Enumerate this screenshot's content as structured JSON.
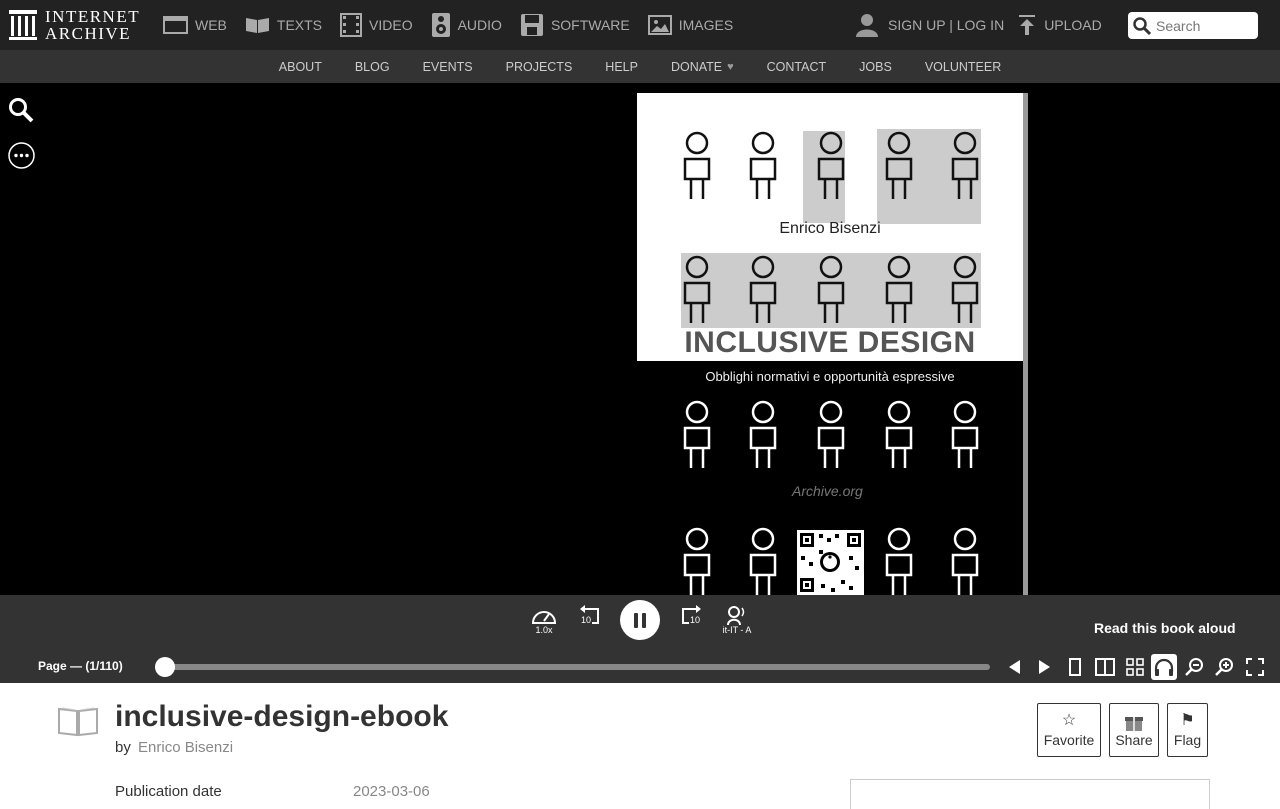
{
  "brand": {
    "line1": "INTERNET",
    "line2": "ARCHIVE"
  },
  "media_nav": [
    {
      "label": "WEB",
      "icon": "web-icon"
    },
    {
      "label": "TEXTS",
      "icon": "texts-icon"
    },
    {
      "label": "VIDEO",
      "icon": "video-icon"
    },
    {
      "label": "AUDIO",
      "icon": "audio-icon"
    },
    {
      "label": "SOFTWARE",
      "icon": "software-icon"
    },
    {
      "label": "IMAGES",
      "icon": "images-icon"
    }
  ],
  "user_nav": {
    "signup_login": "SIGN UP | LOG IN",
    "upload": "UPLOAD"
  },
  "search": {
    "placeholder": "Search"
  },
  "subnav": [
    "ABOUT",
    "BLOG",
    "EVENTS",
    "PROJECTS",
    "HELP",
    "DONATE",
    "CONTACT",
    "JOBS",
    "VOLUNTEER"
  ],
  "book_page": {
    "author": "Enrico Bisenzi",
    "title": "INCLUSIVE DESIGN",
    "subtitle": "Obblighi normativi e opportunità espressive",
    "watermark": "Archive.org"
  },
  "audio": {
    "speed": "1.0x",
    "back_seconds": "10",
    "forward_seconds": "10",
    "voice": "it-IT - A",
    "read_aloud": "Read this book aloud"
  },
  "navbar": {
    "page_label": "Page — (1/110)",
    "current_page": 1,
    "total_pages": 110
  },
  "item": {
    "title": "inclusive-design-ebook",
    "by_label": "by",
    "author": "Enrico Bisenzi",
    "actions": {
      "favorite": "Favorite",
      "share": "Share",
      "flag": "Flag"
    },
    "publication_date_label": "Publication date",
    "publication_date": "2023-03-06"
  },
  "colors": {
    "topbar": "#222222",
    "subnav": "#333333",
    "viewer": "#000000",
    "controls": "#333333"
  }
}
